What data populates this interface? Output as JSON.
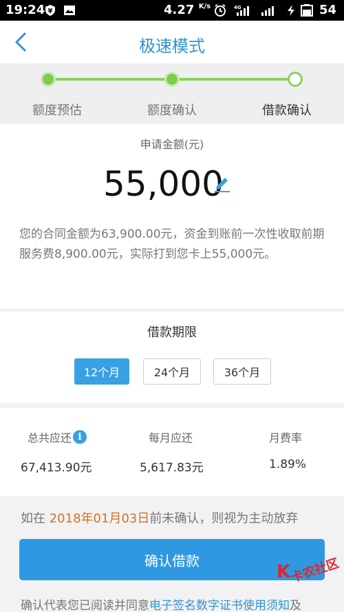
{
  "status_bar": {
    "time": "19:24",
    "speed": "4.27",
    "speed_unit": "K/s",
    "battery": "54",
    "icons": [
      "yuan-notification-icon",
      "image-notification-icon",
      "alarm-icon",
      "signal-4g-icon",
      "signal-icon",
      "charging-icon",
      "battery-icon"
    ]
  },
  "nav": {
    "title": "极速模式",
    "back_icon": "chevron-left-icon"
  },
  "steps": [
    {
      "label": "额度预估",
      "state": "done"
    },
    {
      "label": "额度确认",
      "state": "done"
    },
    {
      "label": "借款确认",
      "state": "current"
    }
  ],
  "amount": {
    "caption": "申请金额(元)",
    "value": "55,000",
    "edit_icon": "pencil-icon",
    "note": "您的合同金额为63,900.00元，资金到账前一次性收取前期服务费8,900.00元，实际打到您卡上55,000元。"
  },
  "term": {
    "caption": "借款期限",
    "options": [
      "12个月",
      "24个月",
      "36个月"
    ],
    "selected": "12个月"
  },
  "stats": {
    "total_label": "总共应还",
    "total_value": "67,413.90元",
    "monthly_label": "每月应还",
    "monthly_value": "5,617.83元",
    "rate_label": "月费率",
    "rate_value": "1.89%"
  },
  "deadline": {
    "prefix": "如在 ",
    "date": "2018年01月03日",
    "suffix": "前未确认，则视为主动放弃"
  },
  "confirm_button": "确认借款",
  "agreement": {
    "prefix": "确认代表您已阅读并同意",
    "link": "电子签名数字证书使用须知",
    "suffix": "及"
  },
  "watermark": {
    "text": "卡农社区",
    "mark": "K"
  },
  "colors": {
    "brand_blue": "#2f98e3",
    "step_green": "#7ccc4d",
    "date_orange": "#d3732a"
  }
}
